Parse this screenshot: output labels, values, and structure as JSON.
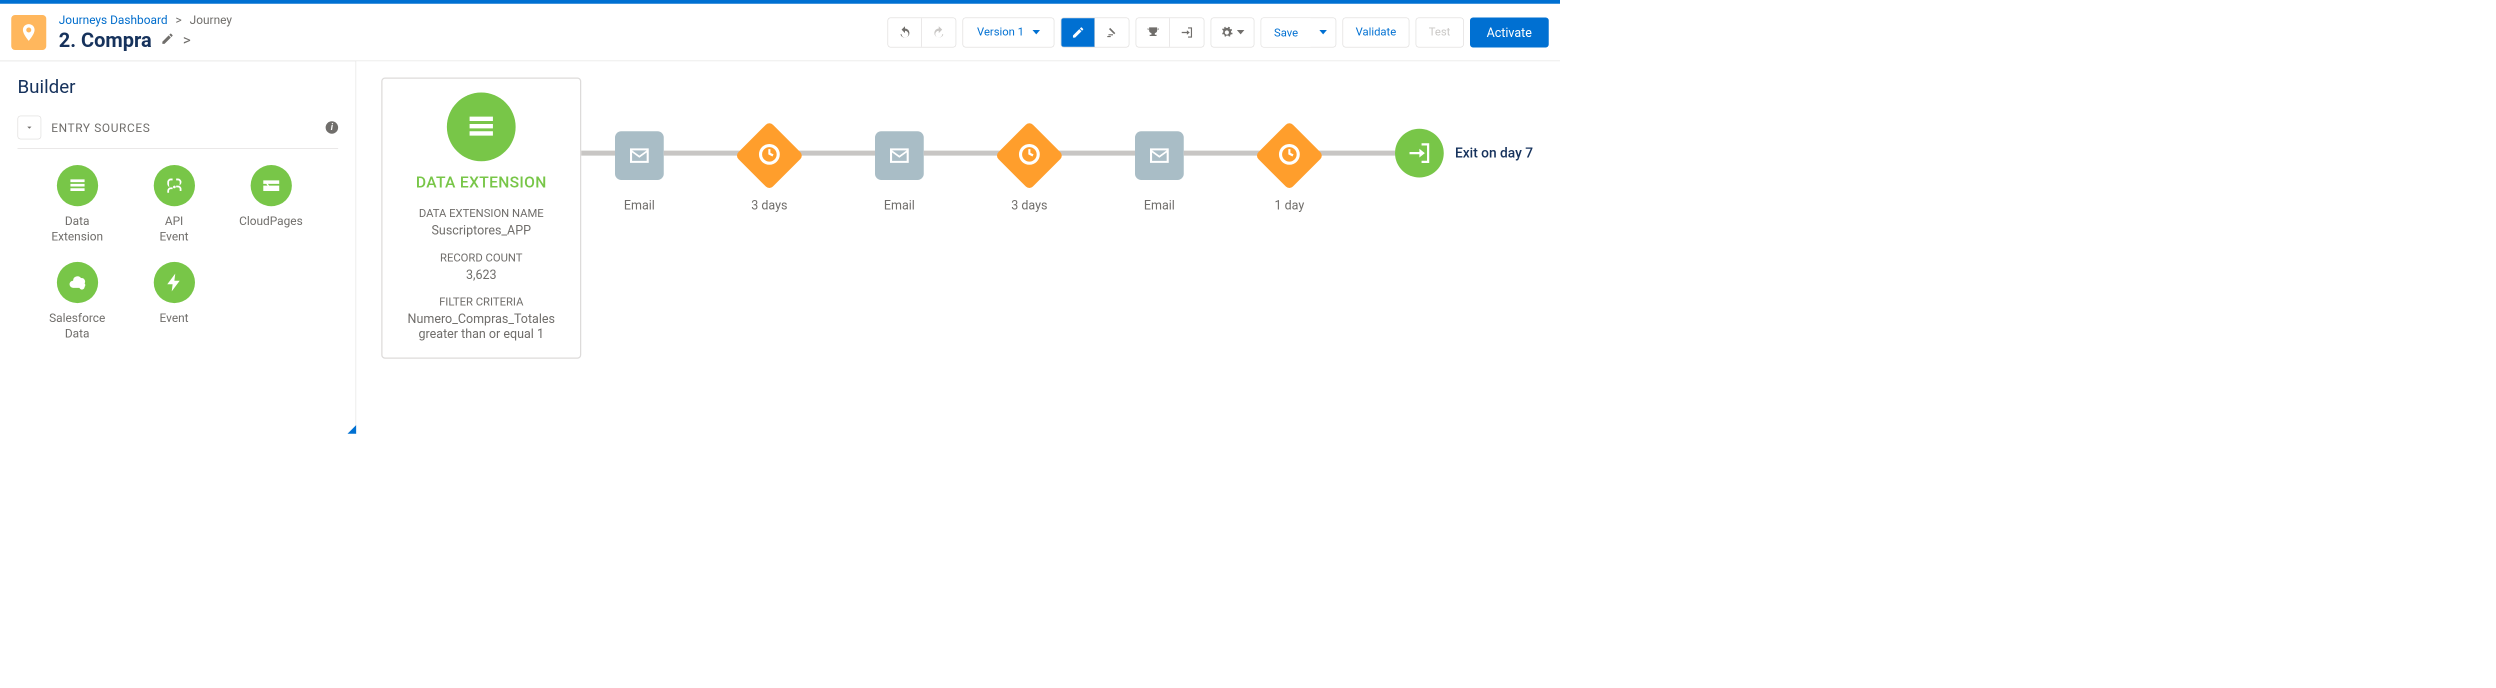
{
  "breadcrumb": {
    "dashboard": "Journeys Dashboard",
    "current": "Journey"
  },
  "journey_title": "2. Compra",
  "toolbar": {
    "version": "Version 1",
    "save": "Save",
    "validate": "Validate",
    "test": "Test",
    "activate": "Activate"
  },
  "sidebar": {
    "title": "Builder",
    "section": "ENTRY SOURCES",
    "items": [
      {
        "label": "Data Extension",
        "icon": "list"
      },
      {
        "label": "API Event",
        "icon": "api"
      },
      {
        "label": "CloudPages",
        "icon": "cloudpage"
      },
      {
        "label": "Salesforce Data",
        "icon": "sfdata"
      },
      {
        "label": "Event",
        "icon": "event"
      }
    ]
  },
  "entry_card": {
    "heading": "DATA EXTENSION",
    "name_label": "DATA EXTENSION NAME",
    "name_value": "Suscriptores_APP",
    "count_label": "RECORD COUNT",
    "count_value": "3,623",
    "filter_label": "FILTER CRITERIA",
    "filter_value": "Numero_Compras_Totales greater than or equal 1"
  },
  "nodes": [
    {
      "type": "email",
      "label": "Email"
    },
    {
      "type": "wait",
      "label": "3 days"
    },
    {
      "type": "email",
      "label": "Email"
    },
    {
      "type": "wait",
      "label": "3 days"
    },
    {
      "type": "email",
      "label": "Email"
    },
    {
      "type": "wait",
      "label": "1 day"
    }
  ],
  "exit_label": "Exit on day 7"
}
